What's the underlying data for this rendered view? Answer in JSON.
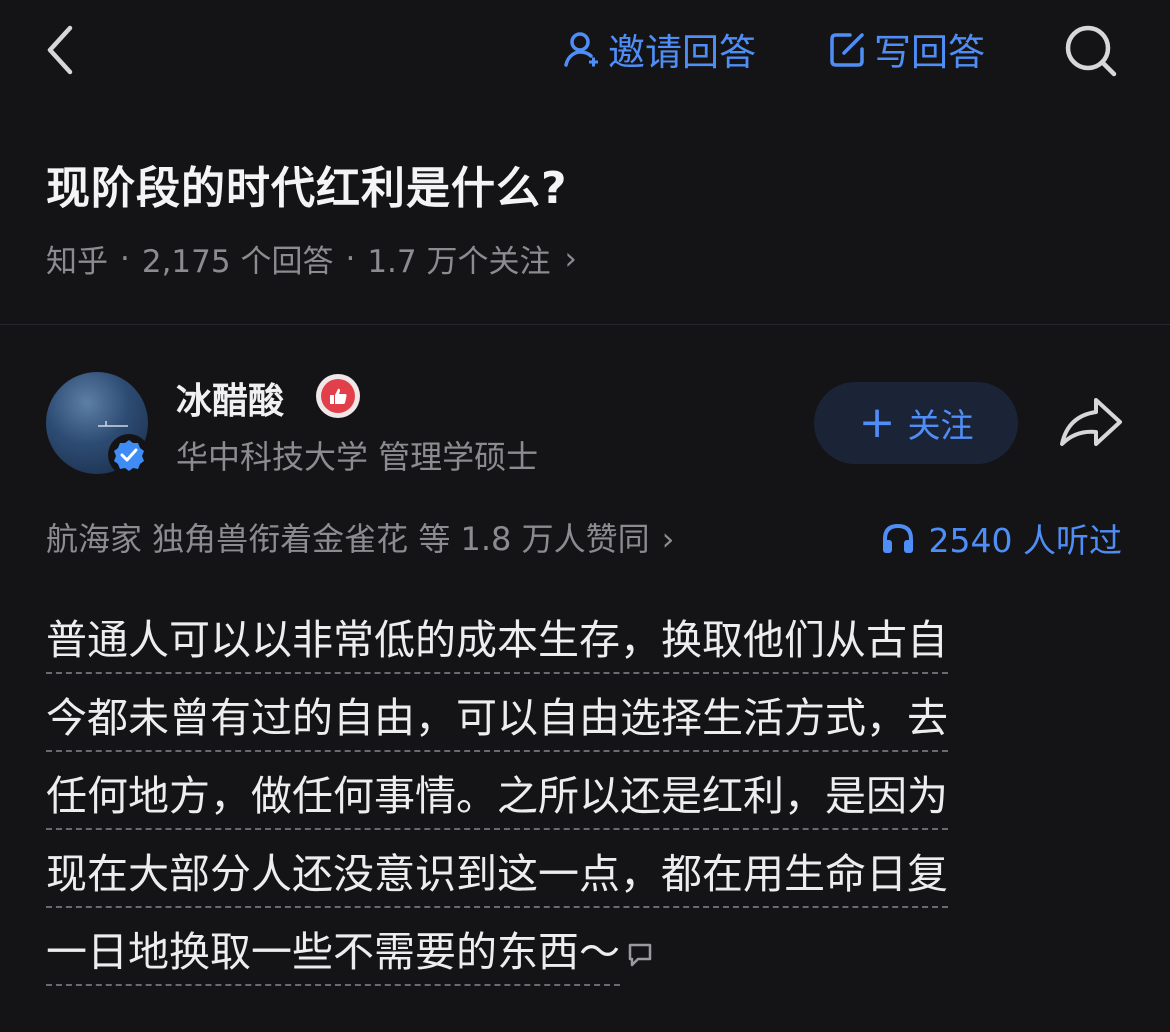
{
  "topbar": {
    "back_icon": "chevron-left-icon",
    "invite_label": "邀请回答",
    "write_label": "写回答",
    "search_icon": "search-icon",
    "accent_color": "#4f8ef7"
  },
  "question": {
    "title": "现阶段的时代红利是什么?",
    "source": "知乎",
    "answers": "2,175 个回答",
    "followers": "1.7 万个关注",
    "separator": "·",
    "chevron": "›"
  },
  "answer": {
    "author": {
      "name": "冰醋酸",
      "description": "华中科技大学 管理学硕士",
      "verified": true
    },
    "follow_label": "关注",
    "follow_plus": "+",
    "approvals": "航海家 独角兽衔着金雀花 等 1.8 万人赞同",
    "approvals_chevron": "›",
    "listened": "2540 人听过",
    "content_lines": [
      "普通人可以以非常低的成本生存，换取他们从古自",
      "今都未曾有过的自由，可以自由选择生活方式，去",
      "任何地方，做任何事情。之所以还是红利，是因为",
      "现在大部分人还没意识到这一点，都在用生命日复",
      "一日地换取一些不需要的东西～"
    ]
  }
}
